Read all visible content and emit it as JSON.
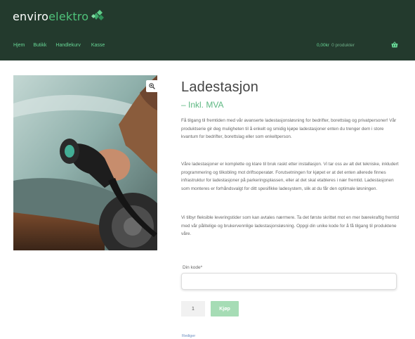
{
  "brand": {
    "part1": "enviro",
    "part2": "elektro"
  },
  "nav": {
    "items": [
      "Hjem",
      "Butikk",
      "Handlekurv",
      "Kasse"
    ]
  },
  "cart": {
    "total": "0,00kr",
    "count": "0 produkter"
  },
  "product": {
    "title": "Ladestasjon",
    "price": "– Inkl. MVA",
    "description": [
      "Få tilgang til fremtiden med vår avanserte ladestasjonsløsning for bedrifter, borettslag og privatpersoner! Vår produktserie gir deg muligheten til å enkelt og smidig kjøpe ladestasjoner enten du trenger dem i store kvantum for bedrifter, borettslag eller som enkeltperson.",
      "Våre ladestasjoner er komplette og klare til bruk raskt etter installasjon. Vi tar oss av alt det tekniske, inkludert programmering og tilkobling mot driftsoperatør. Forutsetningen for kjøpet er at det enten allerede finnes infrastruktur for ladestasjoner på parkeringsplassen, eller at det skal etableres i nær fremtid. Ladestasjonen som monteres er forhåndsvalgt for ditt spesifikke ladesystem, slik at du får den optimale løsningen.",
      "Vi tilbyr fleksible leveringstider som kan avtales nærmere. Ta det første skrittet mot en mer bærekraftig fremtid med vår pålitelige og brukervennlige ladestasjonsløsning. Oppgi din unike kode for å få tilgang til produktene våre."
    ]
  },
  "form": {
    "code_label": "Din kode*",
    "code_value": "",
    "quantity": "1",
    "buy_label": "Kjøp"
  },
  "edit_link": "Rediger",
  "icons": {
    "zoom": "zoom-in-icon",
    "cart": "basket-icon",
    "logo": "leaf-diamond-icon"
  },
  "colors": {
    "header_bg": "#233a2d",
    "accent": "#5db882",
    "button": "#a6dcb5",
    "nav_text": "#67d695"
  }
}
